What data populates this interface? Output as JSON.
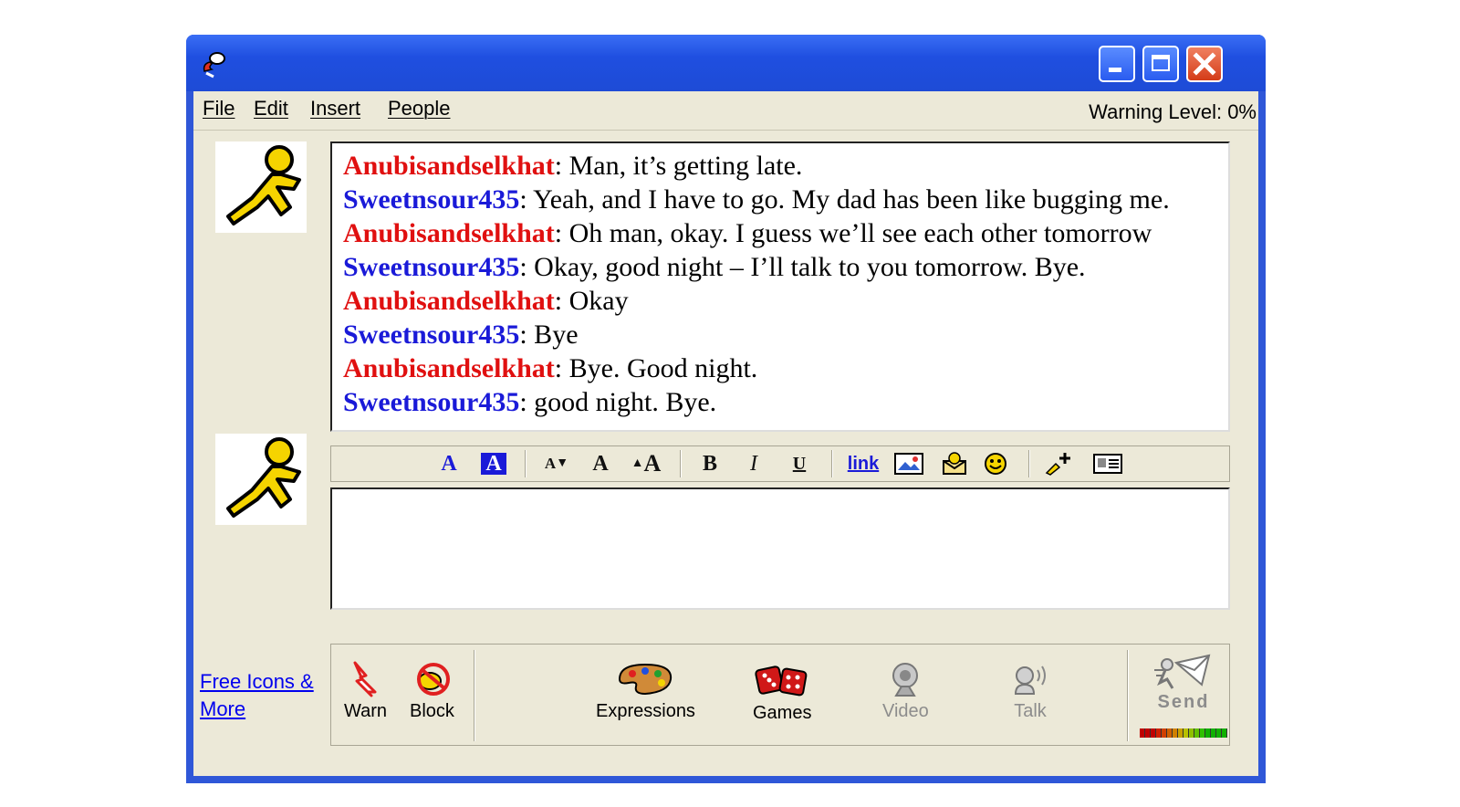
{
  "menu": {
    "file": "File",
    "edit": "Edit",
    "insert": "Insert",
    "people": "People"
  },
  "warning_level": "Warning Level: 0%",
  "colors": {
    "red_sn": "#e01010",
    "blue_sn": "#1a1ad8",
    "aim_yellow": "#f5d400"
  },
  "transcript": [
    {
      "sn": "Anubisandselkhat",
      "color": "red",
      "text": ": Man, it’s getting late."
    },
    {
      "sn": "Sweetnsour435",
      "color": "blue",
      "text": ": Yeah, and I have to go. My dad has been like bugging me."
    },
    {
      "sn": "Anubisandselkhat",
      "color": "red",
      "text": ": Oh man, okay. I guess we’ll see each other tomorrow"
    },
    {
      "sn": "Sweetnsour435",
      "color": "blue",
      "text": ": Okay, good night – I’ll talk to you tomorrow. Bye."
    },
    {
      "sn": "Anubisandselkhat",
      "color": "red",
      "text": ": Okay"
    },
    {
      "sn": "Sweetnsour435",
      "color": "blue",
      "text": ": Bye"
    },
    {
      "sn": "Anubisandselkhat",
      "color": "red",
      "text": ": Bye. Good night."
    },
    {
      "sn": "Sweetnsour435",
      "color": "blue",
      "text": ": good night. Bye."
    }
  ],
  "format": {
    "text_color": "A",
    "bg_color": "A",
    "smaller": "A",
    "normal": "A",
    "larger": "A",
    "bold": "B",
    "italic": "I",
    "underline": "U",
    "link": "link"
  },
  "free_icons_link": "Free Icons & More",
  "buttons": {
    "warn": "Warn",
    "block": "Block",
    "expressions": "Expressions",
    "games": "Games",
    "video": "Video",
    "talk": "Talk",
    "send": "Send"
  }
}
